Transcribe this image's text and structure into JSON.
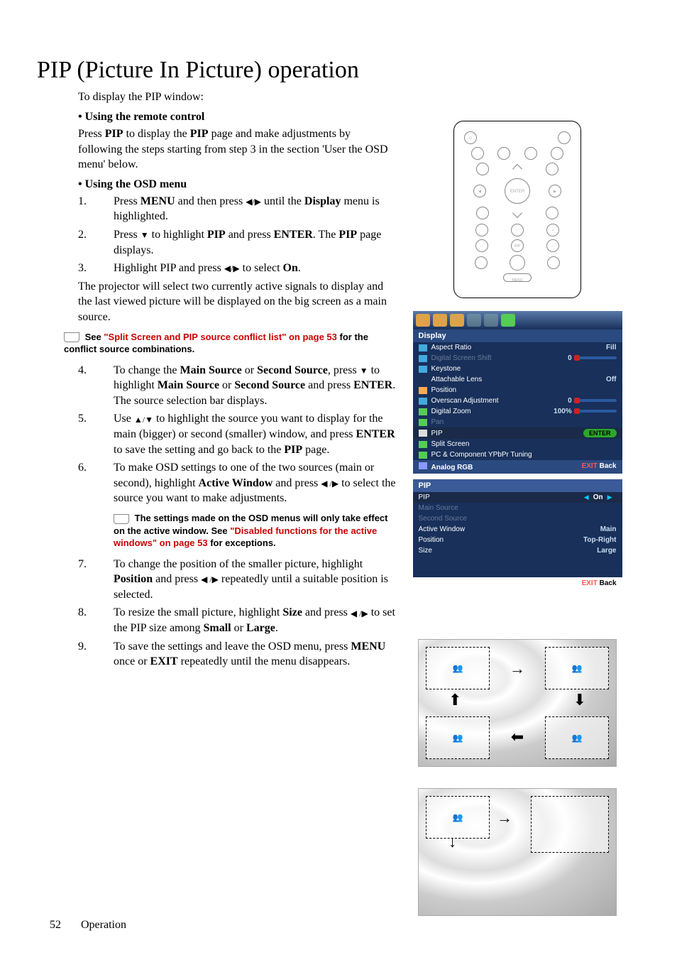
{
  "title": "PIP (Picture In Picture) operation",
  "intro": "To display the PIP window:",
  "bullet1": "Using the remote control",
  "para1a": "Press ",
  "para1b": "PIP",
  "para1c": " to display the ",
  "para1d": "PIP",
  "para1e": " page and make adjustments by following the steps starting from step 3 in the section 'User the OSD menu' below.",
  "bullet2": "Using the OSD menu",
  "step1_num": "1.",
  "step1a": "Press ",
  "step1b": "MENU",
  "step1c": " and then press ",
  "step1d": " until the ",
  "step1e": "Display",
  "step1f": " menu is highlighted.",
  "step2_num": "2.",
  "step2a": "Press ",
  "step2b": " to highlight ",
  "step2c": "PIP",
  "step2d": " and press ",
  "step2e": "ENTER",
  "step2f": ". The ",
  "step2g": "PIP",
  "step2h": " page displays.",
  "step3_num": "3.",
  "step3a": "Highlight PIP and press ",
  "step3b": " to select ",
  "step3c": "On",
  "step3d": ".",
  "para_after3": "The projector will select two currently active signals to display and the last viewed picture will be displayed on the big screen as a main source.",
  "note1a": "See ",
  "note1link": "\"Split Screen and PIP source conflict list\" on page 53",
  "note1b": " for the conflict source combinations.",
  "step4_num": "4.",
  "step4a": "To change the ",
  "step4b": "Main Source",
  "step4c": " or ",
  "step4d": "Second Source",
  "step4e": ", press ",
  "step4f": " to highlight ",
  "step4g": "Main Source",
  "step4h": " or ",
  "step4i": "Second Source",
  "step4j": " and press ",
  "step4k": "ENTER",
  "step4l": ". The source selection bar displays.",
  "step5_num": "5.",
  "step5a": "Use ",
  "step5b": " to highlight the source you want to display for the main (bigger) or second (smaller) window, and press ",
  "step5c": "ENTER",
  "step5d": " to save the setting and go back to the ",
  "step5e": "PIP",
  "step5f": " page.",
  "step6_num": "6.",
  "step6a": "To make OSD settings to one of the two sources (main or second), highlight ",
  "step6b": "Active Window",
  "step6c": " and press ",
  "step6d": " to select the source you want to make adjustments.",
  "note2a": "The settings made on the OSD menus will only take effect on the active window. See ",
  "note2link": "\"Disabled functions for the active windows\" on page 53",
  "note2b": " for exceptions.",
  "step7_num": "7.",
  "step7a": "To change the position of the smaller picture, highlight ",
  "step7b": "Position",
  "step7c": " and press ",
  "step7d": " repeatedly until a suitable position is selected.",
  "step8_num": "8.",
  "step8a": "To resize the small picture, highlight ",
  "step8b": "Size",
  "step8c": " and press ",
  "step8d": " to set the PIP size among ",
  "step8e": "Small",
  "step8f": " or ",
  "step8g": "Large",
  "step8h": ".",
  "step9_num": "9.",
  "step9a": "To save the settings and leave the OSD menu, press ",
  "step9b": "MENU",
  "step9c": " once or ",
  "step9d": "EXIT",
  "step9e": " repeatedly until the menu disappears.",
  "osd1_title": "Display",
  "osd1_r1_l": "Aspect Ratio",
  "osd1_r1_v": "Fill",
  "osd1_r2_l": "Digital Screen Shift",
  "osd1_r2_v": "0",
  "osd1_r3_l": "Keystone",
  "osd1_r4_l": "Attachable Lens",
  "osd1_r4_v": "Off",
  "osd1_r5_l": "Position",
  "osd1_r6_l": "Overscan Adjustment",
  "osd1_r6_v": "0",
  "osd1_r7_l": "Digital Zoom",
  "osd1_r7_v": "100%",
  "osd1_r8_l": "Pan",
  "osd1_r9_l": "PIP",
  "osd1_r9_v": "ENTER",
  "osd1_r10_l": "Split Screen",
  "osd1_r11_l": "PC & Component YPbPr Tuning",
  "osd1_foot_l": "Analog RGB",
  "osd1_foot_exit": "EXIT",
  "osd1_foot_back": "Back",
  "osd2_title": "PIP",
  "osd2_r1_l": "PIP",
  "osd2_r1_v": "On",
  "osd2_r2_l": "Main Source",
  "osd2_r3_l": "Second Source",
  "osd2_r4_l": "Active Window",
  "osd2_r4_v": "Main",
  "osd2_r5_l": "Position",
  "osd2_r5_v": "Top-Right",
  "osd2_r6_l": "Size",
  "osd2_r6_v": "Large",
  "osd2_foot_exit": "EXIT",
  "osd2_foot_back": "Back",
  "page_num": "52",
  "page_section": "Operation"
}
